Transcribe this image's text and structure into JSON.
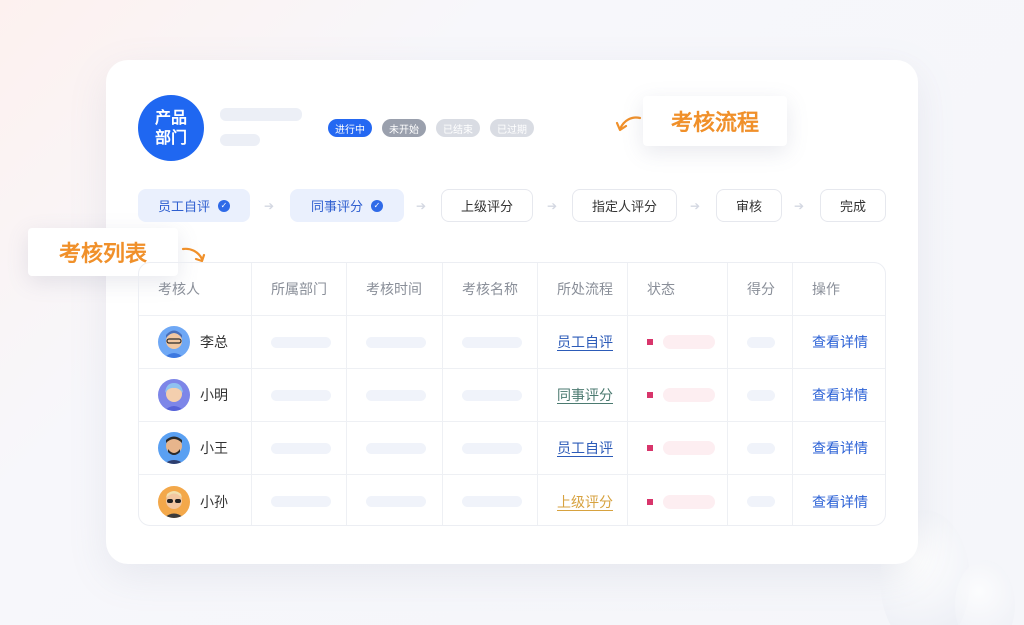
{
  "department": {
    "badge": "产品部门"
  },
  "status_chips": [
    "进行中",
    "未开始",
    "已结束",
    "已过期"
  ],
  "callouts": {
    "flow": "考核流程",
    "list": "考核列表"
  },
  "steps": [
    {
      "label": "员工自评",
      "done": true
    },
    {
      "label": "同事评分",
      "done": true
    },
    {
      "label": "上级评分",
      "done": false
    },
    {
      "label": "指定人评分",
      "done": false
    },
    {
      "label": "审核",
      "done": false
    },
    {
      "label": "完成",
      "done": false
    }
  ],
  "table": {
    "headers": [
      "考核人",
      "所属部门",
      "考核时间",
      "考核名称",
      "所处流程",
      "状态",
      "得分",
      "操作"
    ],
    "rows": [
      {
        "name": "李总",
        "flow": "员工自评",
        "flow_color": "#2c5bb8",
        "action": "查看详情"
      },
      {
        "name": "小明",
        "flow": "同事评分",
        "flow_color": "#4b7a70",
        "action": "查看详情"
      },
      {
        "name": "小王",
        "flow": "员工自评",
        "flow_color": "#2c5bb8",
        "action": "查看详情"
      },
      {
        "name": "小孙",
        "flow": "上级评分",
        "flow_color": "#d7a23f",
        "action": "查看详情"
      }
    ]
  },
  "colors": {
    "brand": "#1f67f1",
    "accent": "#f0902a",
    "status_dot": "#d8356b"
  }
}
